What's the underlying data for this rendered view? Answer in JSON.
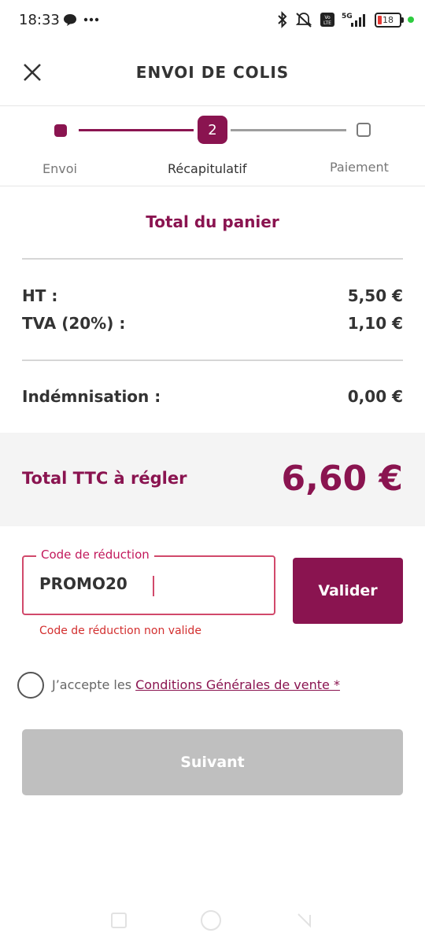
{
  "status_bar": {
    "time": "18:33",
    "left_icons": [
      "chat-bubble-icon",
      "more-dots-icon"
    ],
    "right_icons": [
      "bluetooth-icon",
      "mute-icon",
      "volte-icon",
      "signal-5g-icon",
      "battery-icon"
    ],
    "network": "5G",
    "battery_level": "18"
  },
  "header": {
    "title": "ENVOI DE COLIS"
  },
  "stepper": {
    "current_step": "2",
    "steps": [
      {
        "label": "Envoi",
        "state": "done"
      },
      {
        "label": "Récapitulatif",
        "state": "current"
      },
      {
        "label": "Paiement",
        "state": "upcoming"
      }
    ]
  },
  "cart": {
    "title": "Total du panier",
    "ht_label": "HT :",
    "ht_value": "5,50 €",
    "tva_label": "TVA (20%) :",
    "tva_value": "1,10 €",
    "indemnisation_label": "Indémnisation :",
    "indemnisation_value": "0,00 €",
    "total_label": "Total TTC à régler",
    "total_value": "6,60 €"
  },
  "promo": {
    "label": "Code de réduction",
    "value": "PROMO20",
    "error": "Code de réduction non valide",
    "button_label": "Valider"
  },
  "terms": {
    "prefix": "J’accepte les ",
    "link": "Conditions Générales de vente *",
    "checked": false
  },
  "next_button": {
    "label": "Suivant",
    "enabled": false
  },
  "colors": {
    "brand": "#8a1450",
    "error": "#d32f2f",
    "disabled": "#bfbfbf"
  }
}
